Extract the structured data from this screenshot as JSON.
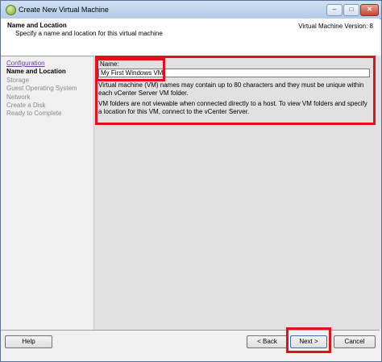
{
  "window": {
    "title": "Create New Virtual Machine",
    "controls": {
      "minimize": "–",
      "maximize": "□",
      "close": "✕"
    }
  },
  "header": {
    "title": "Name and Location",
    "subtitle": "Specify a name and location for this virtual machine",
    "version": "Virtual Machine Version: 8"
  },
  "steps": [
    {
      "label": "Configuration"
    },
    {
      "label": "Name and Location"
    },
    {
      "label": "Storage"
    },
    {
      "label": "Guest Operating System"
    },
    {
      "label": "Network"
    },
    {
      "label": "Create a Disk"
    },
    {
      "label": "Ready to Complete"
    }
  ],
  "form": {
    "name_label": "Name:",
    "name_value": "My First Windows VM",
    "info1": "Virtual machine (VM) names may contain up to 80 characters and they must be unique within each vCenter Server VM folder.",
    "info2": "VM folders are not viewable when connected directly to a host. To view VM folders and specify a location for this VM, connect to the vCenter Server."
  },
  "buttons": {
    "help": "Help",
    "back": "< Back",
    "next": "Next >",
    "cancel": "Cancel"
  },
  "colors": {
    "highlight": "#e0101d",
    "link": "#6b3fa0"
  }
}
